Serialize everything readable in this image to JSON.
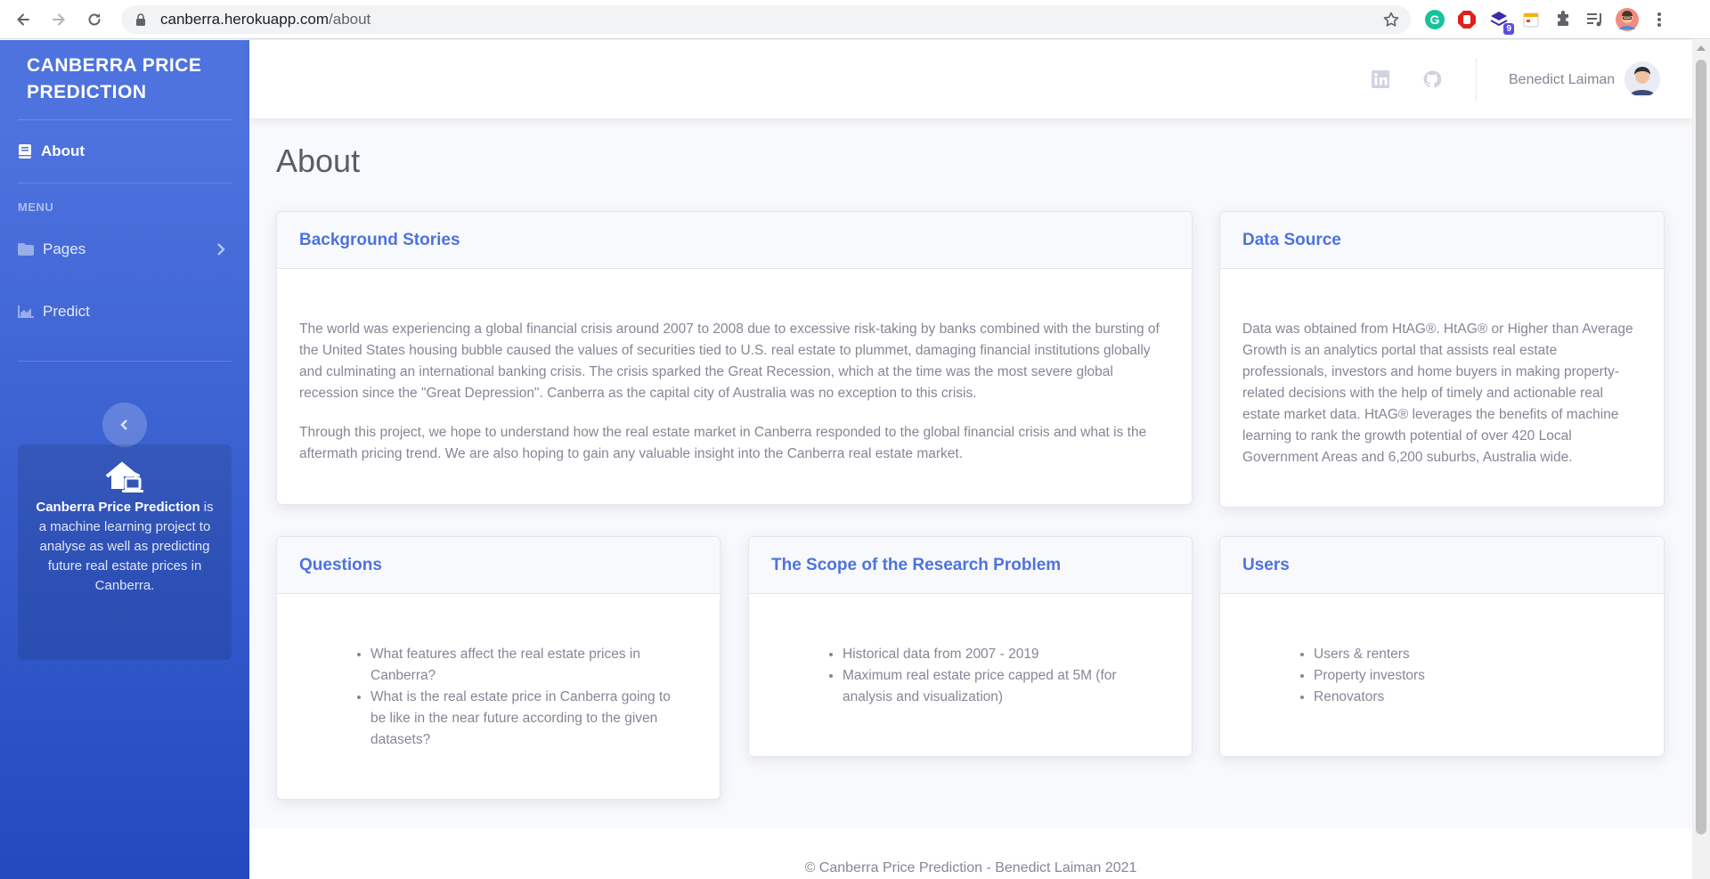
{
  "browser": {
    "url_host": "canberra.herokuapp.com",
    "url_path": "/about",
    "extension_badge": "9"
  },
  "sidebar": {
    "brand_line1": "CANBERRA PRICE",
    "brand_line2": "PREDICTION",
    "about_label": "About",
    "menu_heading": "MENU",
    "pages_label": "Pages",
    "predict_label": "Predict",
    "card_title": "Canberra Price Prediction",
    "card_text": " is a machine learning project to analyse as well as predicting future real estate prices in Canberra."
  },
  "topbar": {
    "user_name": "Benedict Laiman"
  },
  "page": {
    "title": "About"
  },
  "cards": {
    "background": {
      "title": "Background Stories",
      "paragraphs": [
        "The world was experiencing a global financial crisis around 2007 to 2008 due to excessive risk-taking by banks combined with the bursting of the United States housing bubble caused the values of securities tied to U.S. real estate to plummet, damaging financial institutions globally and culminating an international banking crisis. The crisis sparked the Great Recession, which at the time was the most severe global recession since the \"Great Depression\". Canberra as the capital city of Australia was no exception to this crisis.",
        "Through this project, we hope to understand how the real estate market in Canberra responded to the global financial crisis and what is the aftermath pricing trend. We are also hoping to gain any valuable insight into the Canberra real estate market."
      ]
    },
    "data_source": {
      "title": "Data Source",
      "text": "Data was obtained from HtAG®. HtAG® or Higher than Average Growth is an analytics portal that assists real estate professionals, investors and home buyers in making property-related decisions with the help of timely and actionable real estate market data. HtAG® leverages the benefits of machine learning to rank the growth potential of over 420 Local Government Areas and 6,200 suburbs, Australia wide."
    },
    "questions": {
      "title": "Questions",
      "items": [
        "What features affect the real estate prices in Canberra?",
        "What is the real estate price in Canberra going to be like in the near future according to the given datasets?"
      ]
    },
    "scope": {
      "title": "The Scope of the Research Problem",
      "items": [
        "Historical data from 2007 - 2019",
        "Maximum real estate price capped at 5M (for analysis and visualization)"
      ]
    },
    "users": {
      "title": "Users",
      "items": [
        "Users & renters",
        "Property investors",
        "Renovators"
      ]
    }
  },
  "footer": {
    "text": "© Canberra Price Prediction - Benedict Laiman 2021"
  },
  "colors": {
    "primary": "#4e73df",
    "sidebar_bottom": "#224abe",
    "text_muted": "#858796",
    "heading": "#5a5c69"
  }
}
